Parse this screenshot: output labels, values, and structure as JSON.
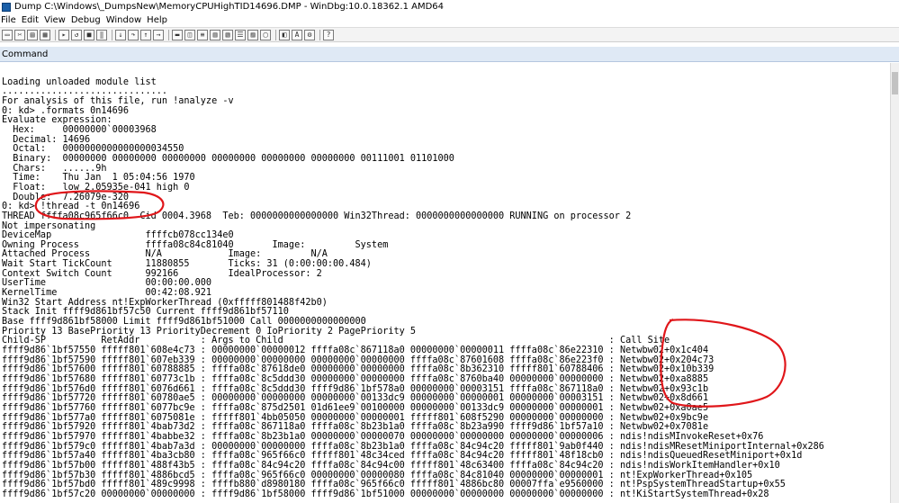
{
  "window": {
    "title": "Dump C:\\Windows\\_DumpsNew\\MemoryCPUHighTID14696.DMP - WinDbg:10.0.18362.1 AMD64"
  },
  "menu": [
    "File",
    "Edit",
    "View",
    "Debug",
    "Window",
    "Help"
  ],
  "panel": {
    "title": "Command"
  },
  "console": {
    "lines": [
      "",
      "Loading unloaded module list",
      "..............................",
      "For analysis of this file, run !analyze -v",
      "0: kd> .formats 0n14696",
      "Evaluate expression:",
      "  Hex:     00000000`00003968",
      "  Decimal: 14696",
      "  Octal:   0000000000000000034550",
      "  Binary:  00000000 00000000 00000000 00000000 00000000 00000000 00111001 01101000",
      "  Chars:   ......9h",
      "  Time:    Thu Jan  1 05:04:56 1970",
      "  Float:   low 2.05935e-041 high 0",
      "  Double:  7.26079e-320",
      "0: kd> !thread -t 0n14696",
      "THREAD ffffa08c965f66c0  Cid 0004.3968  Teb: 0000000000000000 Win32Thread: 0000000000000000 RUNNING on processor 2",
      "Not impersonating",
      "DeviceMap                 ffffcb078cc134e0",
      "Owning Process            ffffa08c84c81040       Image:         System",
      "Attached Process          N/A            Image:         N/A",
      "Wait Start TickCount      11880855       Ticks: 31 (0:00:00:00.484)",
      "Context Switch Count      992166         IdealProcessor: 2",
      "UserTime                  00:00:00.000",
      "KernelTime                00:42:08.921",
      "Win32 Start Address nt!ExpWorkerThread (0xfffff801488f42b0)",
      "Stack Init ffff9d861bf57c50 Current ffff9d861bf57110",
      "Base ffff9d861bf58000 Limit ffff9d861bf51000 Call 0000000000000000",
      "Priority 13 BasePriority 13 PriorityDecrement 0 IoPriority 2 PagePriority 5",
      "Child-SP          RetAddr           : Args to Child                                                           : Call Site",
      "ffff9d86`1bf57550 fffff801`608e4c73 : 00000000`00000012 ffffa08c`867118a0 00000000`00000011 ffffa08c`86e22310 : Netwbw02+0x1c404",
      "ffff9d86`1bf57590 fffff801`607eb339 : 00000000`00000000 00000000`00000000 ffffa08c`87601608 ffffa08c`86e223f0 : Netwbw02+0x204c73",
      "ffff9d86`1bf57600 fffff801`60788885 : ffffa08c`87618de0 00000000`00000000 ffffa08c`8b362310 fffff801`60788406 : Netwbw02+0x10b339",
      "ffff9d86`1bf57680 fffff801`60773c1b : ffffa08c`8c5ddd30 00000000`00000000 ffffa08c`8760ba40 00000000`00000000 : Netwbw02+0xa8885",
      "ffff9d86`1bf576d0 fffff801`6076d661 : ffffa08c`8c5ddd30 ffff9d86`1bf578a0 00000000`00003151 ffffa08c`867118a0 : Netwbw02+0x93c1b",
      "ffff9d86`1bf57720 fffff801`60780ae5 : 00000000`00000000 00000000`00133dc9 00000000`00000001 00000000`00003151 : Netwbw02+0x8d661",
      "ffff9d86`1bf57760 fffff801`6077bc9e : ffffa08c`875d2501 01d61ee9`00100000 00000000`00133dc9 00000000`00000001 : Netwbw02+0xa0ae5",
      "ffff9d86`1bf577a0 fffff801`6075081e : fffff801`4bb05050 00000000`00000001 fffff801`608f5290 00000000`00000000 : Netwbw02+0x9bc9e",
      "ffff9d86`1bf57920 fffff801`4bab73d2 : ffffa08c`867118a0 ffffa08c`8b23b1a0 ffffa08c`8b23a990 ffff9d86`1bf57a10 : Netwbw02+0x7081e",
      "ffff9d86`1bf57970 fffff801`4babbe32 : ffffa08c`8b23b1a0 00000000`00000070 00000000`00000000 00000000`00000006 : ndis!ndisMInvokeReset+0x76",
      "ffff9d86`1bf579c0 fffff801`4bab7a3d : 00000000`00000000 ffffa08c`8b23b1a0 ffffa08c`84c94c20 fffff801`9ab0f440 : ndis!ndisMResetMiniportInternal+0x286",
      "ffff9d86`1bf57a40 fffff801`4ba3cb80 : ffffa08c`965f66c0 fffff801`48c34ced ffffa08c`84c94c20 fffff801`48f18cb0 : ndis!ndisQueuedResetMiniport+0x1d",
      "ffff9d86`1bf57b00 fffff801`488f43b5 : ffffa08c`84c94c20 ffffa08c`84c94c00 fffff801`48c63400 ffffa08c`84c94c20 : ndis!ndisWorkItemHandler+0x10",
      "ffff9d86`1bf57b30 fffff801`4886bcd5 : ffffa08c`965f66c0 00000000`00000080 ffffa08c`84c81040 00000000`00000001 : nt!ExpWorkerThread+0x105",
      "ffff9d86`1bf57bd0 fffff801`489c9998 : ffffb880`d8980180 ffffa08c`965f66c0 fffff801`4886bc80 00007ffa`e9560000 : nt!PspSystemThreadStartup+0x55",
      "ffff9d86`1bf57c20 00000000`00000000 : ffff9d86`1bf58000 ffff9d86`1bf51000 00000000`00000000 00000000`00000000 : nt!KiStartSystemThread+0x28"
    ]
  }
}
